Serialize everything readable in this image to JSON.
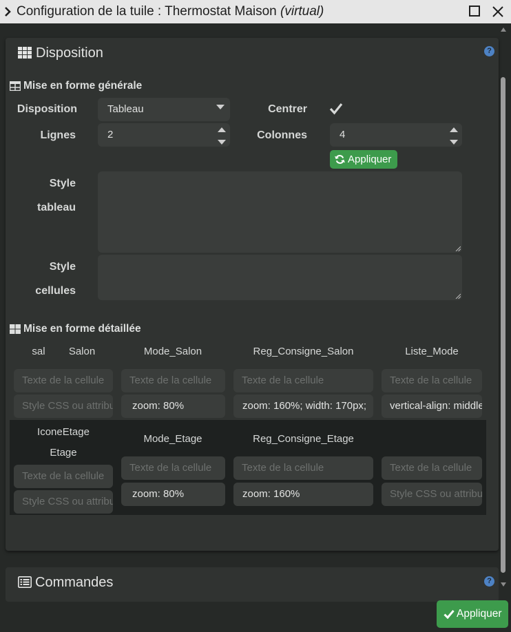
{
  "window": {
    "title": "Configuration de la tuile : Thermostat Maison ",
    "title_suffix": "(virtual)"
  },
  "disposition_panel": {
    "title": "Disposition",
    "help": "?",
    "general": {
      "title": "Mise en forme générale",
      "disposition_label": "Disposition",
      "disposition_value": "Tableau",
      "centrer_label": "Centrer",
      "centrer_checked": true,
      "lignes_label": "Lignes",
      "lignes_value": "2",
      "colonnes_label": "Colonnes",
      "colonnes_value": "4",
      "apply_label": "Appliquer",
      "style_tableau_label_1": "Style",
      "style_tableau_label_2": "tableau",
      "style_cellules_label_1": "Style",
      "style_cellules_label_2": "cellules"
    },
    "detail": {
      "title": "Mise en forme détaillée",
      "placeholder_text": "Texte de la cellule",
      "placeholder_style": "Style CSS ou attributs",
      "row1": {
        "headers": [
          "sal",
          "Salon",
          "Mode_Salon",
          "Reg_Consigne_Salon",
          "Liste_Mode"
        ],
        "styles": [
          "",
          "zoom: 80%",
          "zoom: 160%; width: 170px;",
          "vertical-align: middle"
        ]
      },
      "row2": {
        "headers": [
          "IconeEtage",
          "Etage",
          "Mode_Etage",
          "Reg_Consigne_Etage",
          ""
        ],
        "styles": [
          "",
          "zoom: 80%",
          "zoom: 160%",
          ""
        ]
      }
    }
  },
  "commandes_panel": {
    "title": "Commandes",
    "help": "?"
  },
  "footer": {
    "apply_label": "Appliquer"
  },
  "colors": {
    "accent_green": "#3d9b4c",
    "help_blue": "#4d82c4",
    "panel_bg": "#303331",
    "field_bg": "#3a3d3b"
  }
}
